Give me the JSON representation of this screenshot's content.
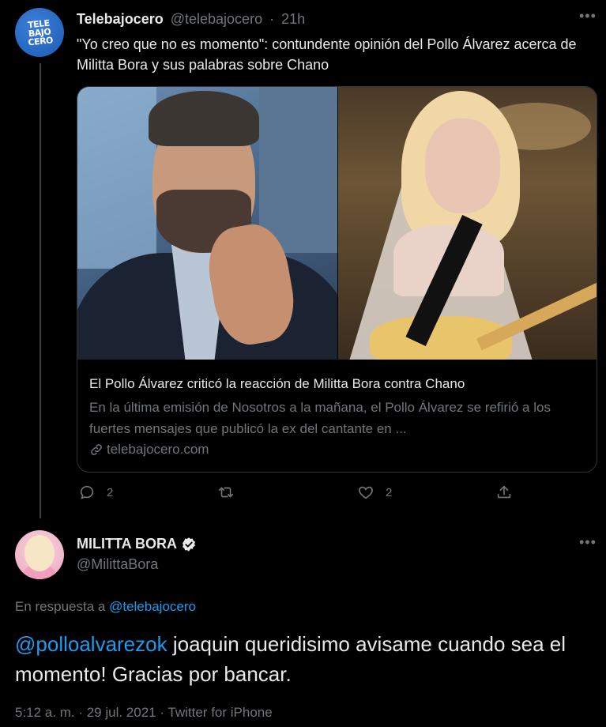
{
  "tweet1": {
    "display_name": "Telebajocero",
    "handle": "@telebajocero",
    "separator": "·",
    "time": "21h",
    "more": "•••",
    "text": "\"Yo creo que no es momento\": contundente opinión del Pollo Álvarez acerca de Militta Bora y sus palabras sobre Chano",
    "avatar_logo": [
      "TELE",
      "BAJO",
      "CERO"
    ],
    "card": {
      "title": "El Pollo Álvarez criticó la reacción de Militta Bora contra Chano",
      "description": "En la última emisión de Nosotros a la mañana, el Pollo Álvarez se refirió a los fuertes mensajes que publicó la ex del cantante en ...",
      "domain": "telebajocero.com"
    },
    "actions": {
      "reply_count": "2",
      "retweet_count": "",
      "like_count": "2"
    }
  },
  "tweet2": {
    "display_name": "MILITTA BORA",
    "handle": "@MilittaBora",
    "more": "•••",
    "reply_prefix": "En respuesta a",
    "reply_mention": "@telebajocero",
    "text_mention": "@polloalvarezok",
    "text_body": " joaquin queridisimo avisame cuando sea el momento! Gracias por bancar.",
    "meta": "5:12 a. m. · 29 jul. 2021 · Twitter for iPhone"
  },
  "colors": {
    "background": "#000000",
    "text": "#e7e9ea",
    "secondary": "#71767b",
    "link": "#1d9bf0",
    "border": "#2f3336"
  }
}
